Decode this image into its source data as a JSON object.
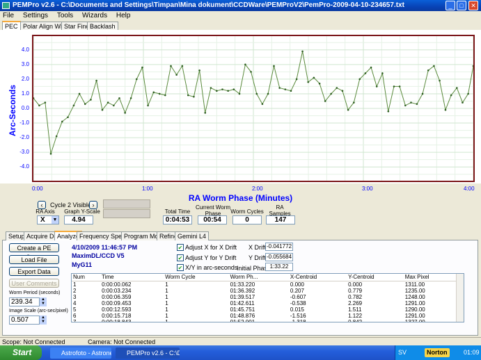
{
  "window": {
    "title": "PEMPro v2.6 - C:\\Documents and Settings\\Timpan\\Mina dokument\\CCDWare\\PEMProV2\\PemPro-2009-04-10-234657.txt"
  },
  "menu": [
    "File",
    "Settings",
    "Tools",
    "Wizards",
    "Help"
  ],
  "top_tabs": [
    "PEC",
    "Polar Align Wizard",
    "Star Finder",
    "Backlash"
  ],
  "chart_data": {
    "type": "line",
    "xlabel": "RA Worm Phase (Minutes)",
    "ylabel": "Arc-Seconds",
    "x_ticks": [
      "0:00",
      "1:00",
      "2:00",
      "3:00",
      "4:00"
    ],
    "y_ticks": [
      "4.0",
      "3.0",
      "2.0",
      "1.0",
      "0.0",
      "-1.0",
      "-2.0",
      "-3.0",
      "-4.0"
    ],
    "ylim": [
      -4.94,
      4.94
    ],
    "xlim": [
      0,
      240
    ],
    "grid": true,
    "color": "#5a8a3c",
    "x": [
      0.0,
      3.2,
      6.4,
      9.5,
      12.6,
      15.7,
      18.8,
      22.0,
      25.1,
      28.2,
      31.3,
      34.4,
      37.6,
      40.7,
      43.8,
      46.9,
      50.0,
      53.2,
      56.3,
      59.4,
      62.5,
      65.6,
      68.8,
      71.9,
      75.0,
      78.1,
      81.2,
      84.4,
      87.5,
      90.6,
      93.7,
      96.8,
      100.0,
      103.1,
      106.2,
      109.3,
      112.4,
      115.6,
      118.7,
      121.8,
      124.9,
      128.0,
      131.2,
      134.3,
      137.4,
      140.5,
      143.6,
      146.8,
      149.9,
      153.0,
      156.1,
      159.2,
      162.4,
      165.5,
      168.6,
      171.7,
      174.8,
      178.0,
      181.1,
      184.2,
      187.3,
      190.4,
      193.6,
      196.7,
      199.8,
      202.9,
      206.0,
      209.2,
      212.3,
      215.4,
      218.5,
      221.6,
      224.8,
      227.9,
      231.0,
      234.1,
      237.2,
      240.0
    ],
    "values": [
      0.7,
      0.2,
      0.4,
      -3.1,
      -1.9,
      -0.9,
      -0.6,
      0.2,
      1.0,
      0.3,
      0.6,
      1.9,
      -0.1,
      0.4,
      0.2,
      0.7,
      -0.3,
      0.7,
      2.0,
      2.8,
      0.2,
      1.1,
      1.0,
      0.9,
      2.9,
      2.3,
      2.9,
      0.9,
      0.8,
      2.6,
      -0.3,
      1.4,
      1.2,
      1.3,
      1.2,
      1.3,
      1.0,
      3.0,
      2.5,
      1.0,
      0.3,
      1.0,
      2.9,
      1.4,
      1.3,
      1.2,
      2.0,
      3.9,
      1.8,
      2.1,
      1.7,
      0.5,
      1.0,
      1.4,
      1.2,
      -0.1,
      0.4,
      2.0,
      2.4,
      2.8,
      1.5,
      2.4,
      -0.2,
      1.5,
      1.5,
      0.2,
      0.4,
      0.3,
      1.0,
      2.6,
      2.9,
      1.9,
      -0.1,
      0.9,
      1.4,
      0.4,
      1.0,
      2.9
    ]
  },
  "chart_data_note": "",
  "controls": {
    "cycle_label": "Cycle 2 Visible",
    "ra_axis_label": "RA Axis",
    "ra_axis_value": "X",
    "graph_yscale_label": "Graph Y-Scale",
    "graph_yscale_value": "4.94",
    "total_time_label": "Total Time",
    "total_time_value": "0:04:53",
    "current_worm_phase_label": "Current Worm Phase",
    "current_worm_phase_value": "00:54",
    "worm_cycles_label": "Worm Cycles",
    "worm_cycles_value": "0",
    "ra_samples_label": "RA Samples",
    "ra_samples_value": "147"
  },
  "bottom_tabs": [
    "Setup",
    "Acquire Data",
    "Analyze",
    "Frequency Spectrum",
    "Program Mount",
    "Refine",
    "Gemini L4"
  ],
  "analyze": {
    "create_pe_curve": "Create a PE Curve",
    "load_file": "Load File",
    "export_data": "Export Data",
    "user_comments": "User Comments",
    "worm_period_label": "Worm Period (seconds)",
    "worm_period_value": "239.34",
    "image_scale_label": "Image Scale (arc-sec/pixel)",
    "image_scale_value": "0.507",
    "date": "4/10/2009 11:46:57 PM",
    "camera": "MaximDL/CCD V5",
    "mount": "MyG11",
    "adjust_x": "Adjust X for X Drift",
    "adjust_y": "Adjust Y for Y Drift",
    "xy_arcsec": "X/Y in arc-seconds",
    "x_drift_label": "X Drift",
    "x_drift_value": "-0.041772",
    "y_drift_label": "Y Drift",
    "y_drift_value": "-0.055684",
    "initial_phase_label": "Initial Phase",
    "initial_phase_value": "1:33.22"
  },
  "table": {
    "headers": [
      "Num",
      "Time",
      "Worm Cycle",
      "Worm Ph...",
      "X-Centroid",
      "Y-Centroid",
      "Max Pixel"
    ],
    "rows": [
      [
        "1",
        "0:00:00.062",
        "1",
        "01:33.220",
        "0.000",
        "0.000",
        "1311.00"
      ],
      [
        "2",
        "0:00:03.234",
        "1",
        "01:36.392",
        "0.207",
        "0.779",
        "1235.00"
      ],
      [
        "3",
        "0:00:06.359",
        "1",
        "01:39.517",
        "-0.607",
        "0.782",
        "1248.00"
      ],
      [
        "4",
        "0:00:09.453",
        "1",
        "01:42.611",
        "-0.538",
        "2.269",
        "1291.00"
      ],
      [
        "5",
        "0:00:12.593",
        "1",
        "01:45.751",
        "0.015",
        "1.511",
        "1290.00"
      ],
      [
        "6",
        "0:00:15.718",
        "1",
        "01:48.876",
        "-1.516",
        "1.122",
        "1291.00"
      ],
      [
        "7",
        "0:00:18.843",
        "1",
        "01:52.001",
        "-1.318",
        "0.842",
        "1327.00"
      ]
    ]
  },
  "status": {
    "scope": "Scope: Not Connected",
    "camera": "Camera: Not Connected"
  },
  "taskbar": {
    "start": "Start",
    "tasks": [
      "Astrofoto - Astronet ...",
      "PEMPro v2.6 - C:\\Doc..."
    ],
    "lang": "SV",
    "norton": "Norton",
    "clock": "01:09"
  }
}
